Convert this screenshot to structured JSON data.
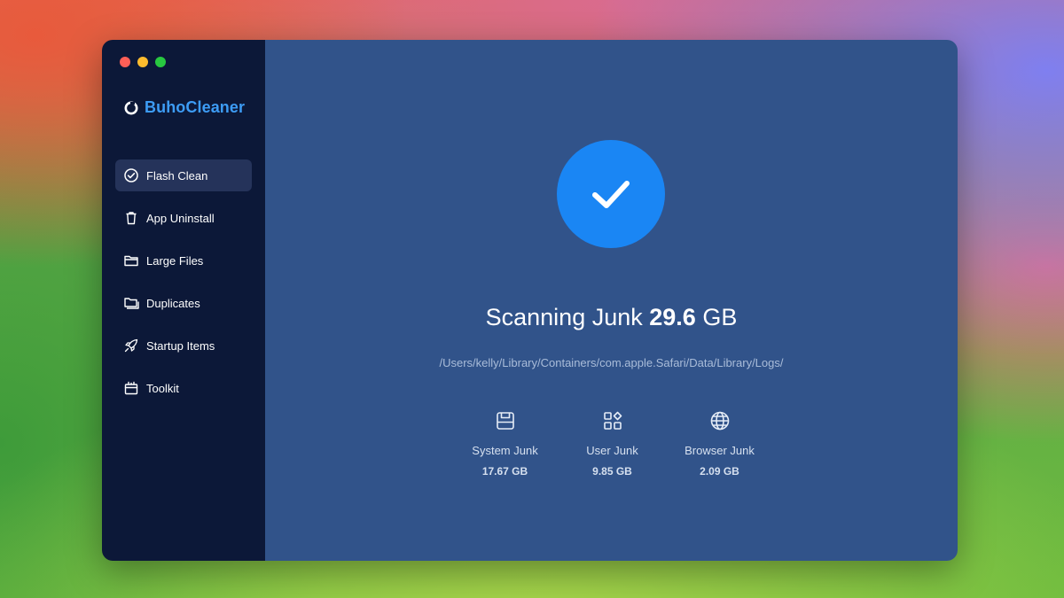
{
  "app": {
    "name": "BuhoCleaner",
    "brand_color": "#3d9cf5"
  },
  "sidebar": {
    "items": [
      {
        "label": "Flash Clean",
        "icon": "check-circle-icon",
        "active": true
      },
      {
        "label": "App Uninstall",
        "icon": "trash-icon",
        "active": false
      },
      {
        "label": "Large Files",
        "icon": "folder-icon",
        "active": false
      },
      {
        "label": "Duplicates",
        "icon": "duplicate-folder-icon",
        "active": false
      },
      {
        "label": "Startup Items",
        "icon": "rocket-icon",
        "active": false
      },
      {
        "label": "Toolkit",
        "icon": "toolkit-icon",
        "active": false
      }
    ]
  },
  "scan": {
    "status_prefix": "Scanning Junk",
    "total_size": "29.6",
    "total_unit": "GB",
    "current_path": "/Users/kelly/Library/Containers/com.apple.Safari/Data/Library/Logs/",
    "status_icon": "checkmark-icon",
    "accent_color": "#1a86f4"
  },
  "stats": [
    {
      "label": "System Junk",
      "value": "17.67 GB",
      "icon": "drive-icon"
    },
    {
      "label": "User Junk",
      "value": "9.85 GB",
      "icon": "apps-grid-icon"
    },
    {
      "label": "Browser Junk",
      "value": "2.09 GB",
      "icon": "globe-icon"
    }
  ]
}
